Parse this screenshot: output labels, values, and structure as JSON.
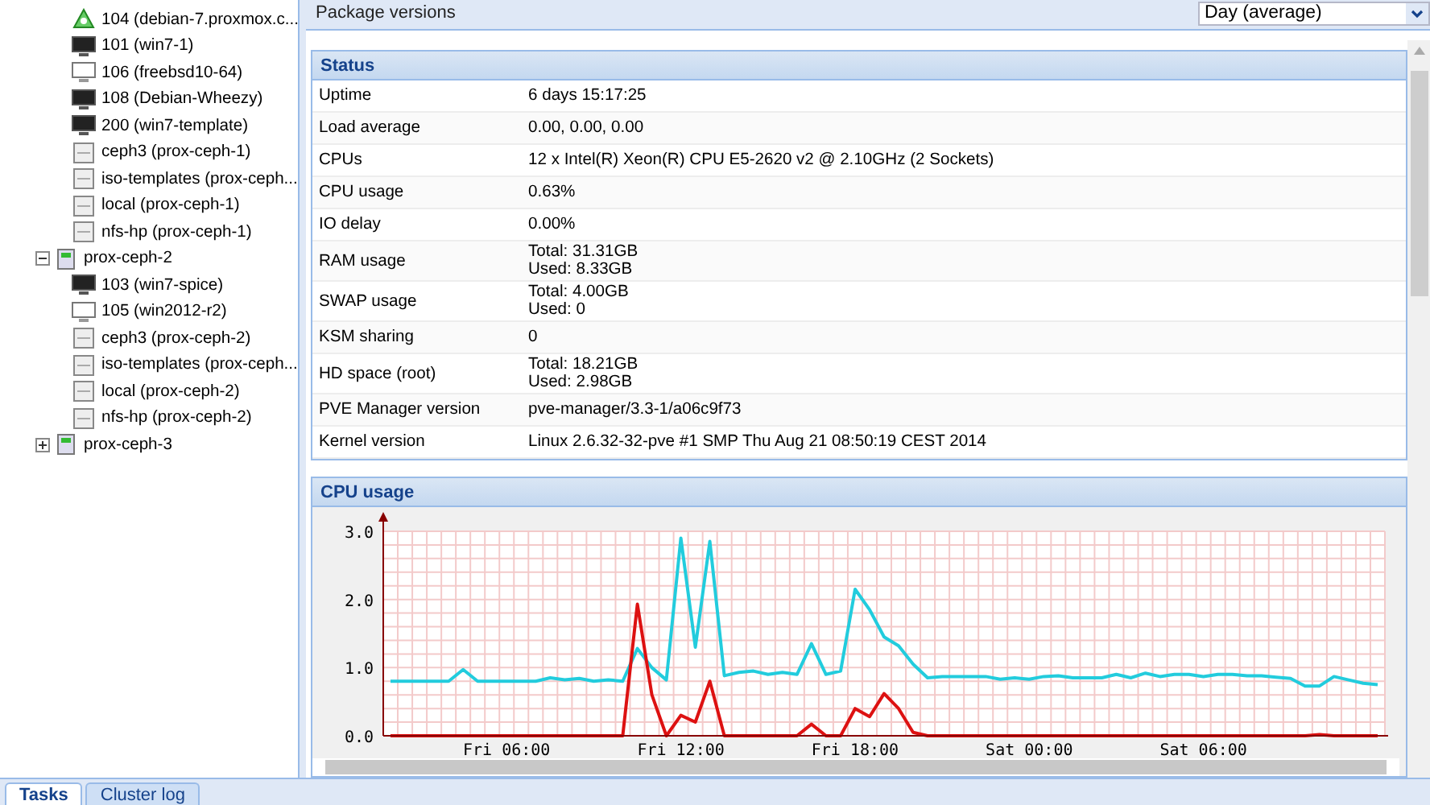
{
  "tree": {
    "nodes": [
      {
        "children": [
          {
            "label": "104 (debian-7.proxmox.c...",
            "kind": "template"
          },
          {
            "label": "101 (win7-1)",
            "kind": "vm-running"
          },
          {
            "label": "106 (freebsd10-64)",
            "kind": "vm-stopped"
          },
          {
            "label": "108 (Debian-Wheezy)",
            "kind": "vm-running"
          },
          {
            "label": "200 (win7-template)",
            "kind": "vm-running"
          },
          {
            "label": "ceph3 (prox-ceph-1)",
            "kind": "storage"
          },
          {
            "label": "iso-templates (prox-ceph...",
            "kind": "storage"
          },
          {
            "label": "local (prox-ceph-1)",
            "kind": "storage"
          },
          {
            "label": "nfs-hp (prox-ceph-1)",
            "kind": "storage"
          }
        ]
      },
      {
        "label": "prox-ceph-2",
        "kind": "node",
        "expanded": true,
        "children": [
          {
            "label": "103 (win7-spice)",
            "kind": "vm-running"
          },
          {
            "label": "105 (win2012-r2)",
            "kind": "vm-stopped"
          },
          {
            "label": "ceph3 (prox-ceph-2)",
            "kind": "storage"
          },
          {
            "label": "iso-templates (prox-ceph...",
            "kind": "storage"
          },
          {
            "label": "local (prox-ceph-2)",
            "kind": "storage"
          },
          {
            "label": "nfs-hp (prox-ceph-2)",
            "kind": "storage"
          }
        ]
      },
      {
        "label": "prox-ceph-3",
        "kind": "node",
        "expanded": false
      }
    ]
  },
  "toolbar": {
    "button": "Package versions",
    "timeframe": "Day (average)"
  },
  "status": {
    "title": "Status",
    "rows": [
      {
        "label": "Uptime",
        "value": [
          "6 days 15:17:25"
        ]
      },
      {
        "label": "Load average",
        "value": [
          "0.00, 0.00, 0.00"
        ]
      },
      {
        "label": "CPUs",
        "value": [
          "12 x Intel(R) Xeon(R) CPU E5-2620 v2 @ 2.10GHz (2 Sockets)"
        ]
      },
      {
        "label": "CPU usage",
        "value": [
          "0.63%"
        ]
      },
      {
        "label": "IO delay",
        "value": [
          "0.00%"
        ]
      },
      {
        "label": "RAM usage",
        "value": [
          "Total: 31.31GB",
          "Used: 8.33GB"
        ]
      },
      {
        "label": "SWAP usage",
        "value": [
          "Total: 4.00GB",
          "Used: 0"
        ]
      },
      {
        "label": "KSM sharing",
        "value": [
          "0"
        ]
      },
      {
        "label": "HD space (root)",
        "value": [
          "Total: 18.21GB",
          "Used: 2.98GB"
        ]
      },
      {
        "label": "PVE Manager version",
        "value": [
          "pve-manager/3.3-1/a06c9f73"
        ]
      },
      {
        "label": "Kernel version",
        "value": [
          "Linux 2.6.32-32-pve #1 SMP Thu Aug 21 08:50:19 CEST 2014"
        ]
      }
    ]
  },
  "cpu_panel": {
    "title": "CPU usage",
    "chart_data": {
      "type": "line",
      "ylim": [
        0,
        3
      ],
      "yticks": [
        {
          "value": 0,
          "label": "0.0"
        },
        {
          "value": 1,
          "label": "1.0"
        },
        {
          "value": 2,
          "label": "2.0"
        },
        {
          "value": 3,
          "label": "3.0"
        }
      ],
      "categories": [
        null,
        null,
        null,
        null,
        null,
        null,
        null,
        null,
        "Fri 06:00",
        null,
        null,
        null,
        null,
        null,
        null,
        null,
        null,
        null,
        null,
        null,
        "Fri 12:00",
        null,
        null,
        null,
        null,
        null,
        null,
        null,
        null,
        null,
        null,
        null,
        "Fri 18:00",
        null,
        null,
        null,
        null,
        null,
        null,
        null,
        null,
        null,
        null,
        null,
        "Sat 00:00",
        null,
        null,
        null,
        null,
        null,
        null,
        null,
        null,
        null,
        null,
        null,
        "Sat 06:00",
        null,
        null,
        null,
        null,
        null,
        null,
        null,
        null,
        null,
        null,
        null,
        null
      ],
      "series": [
        {
          "color": "#22ccdd",
          "values": [
            0.8,
            0.8,
            0.8,
            0.8,
            0.8,
            0.97,
            0.8,
            0.8,
            0.8,
            0.8,
            0.8,
            0.85,
            0.82,
            0.84,
            0.8,
            0.82,
            0.8,
            1.28,
            1.0,
            0.82,
            2.9,
            1.3,
            2.85,
            0.88,
            0.93,
            0.95,
            0.9,
            0.93,
            0.9,
            1.35,
            0.9,
            0.95,
            2.15,
            1.85,
            1.45,
            1.32,
            1.05,
            0.85,
            0.87,
            0.87,
            0.87,
            0.87,
            0.83,
            0.85,
            0.83,
            0.87,
            0.88,
            0.85,
            0.85,
            0.85,
            0.9,
            0.85,
            0.92,
            0.87,
            0.9,
            0.9,
            0.87,
            0.9,
            0.9,
            0.88,
            0.88,
            0.86,
            0.84,
            0.73,
            0.73,
            0.87,
            0.82,
            0.77,
            0.75
          ]
        },
        {
          "color": "#dd1111",
          "values": [
            0,
            0,
            0,
            0,
            0,
            0,
            0,
            0,
            0,
            0,
            0,
            0,
            0,
            0,
            0,
            0,
            0,
            1.93,
            0.6,
            0,
            0.3,
            0.2,
            0.8,
            0,
            0,
            0,
            0,
            0,
            0,
            0.17,
            0,
            0,
            0.4,
            0.28,
            0.62,
            0.4,
            0.05,
            0,
            0,
            0,
            0,
            0,
            0,
            0,
            0,
            0,
            0,
            0,
            0,
            0,
            0,
            0,
            0,
            0,
            0,
            0,
            0,
            0,
            0,
            0,
            0,
            0,
            0,
            0,
            0.02,
            0,
            0,
            0,
            0
          ]
        }
      ]
    }
  },
  "bottom_tabs": [
    {
      "label": "Tasks",
      "selected": true
    },
    {
      "label": "Cluster log",
      "selected": false
    }
  ]
}
